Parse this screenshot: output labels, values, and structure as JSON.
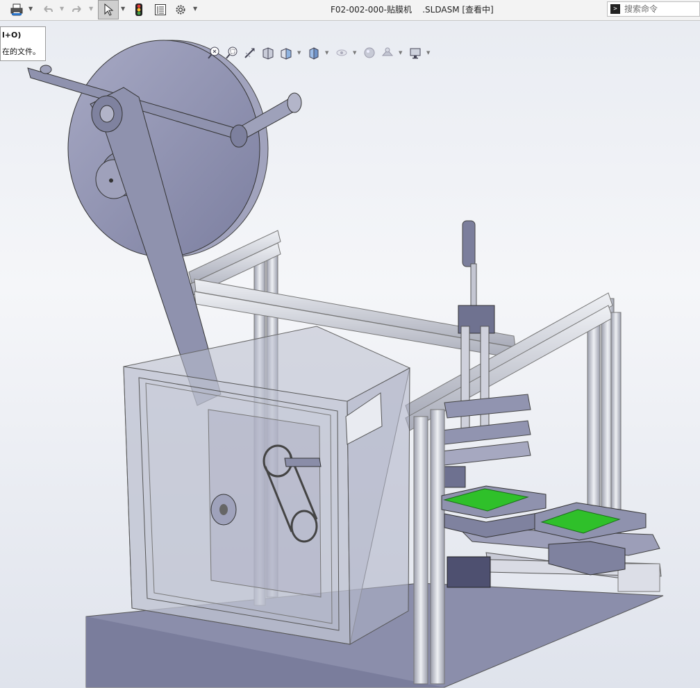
{
  "window": {
    "title": "F02-002-000-贴膜机    .SLDASM [查看中]"
  },
  "toolbar": {
    "icons": [
      "print-icon",
      "undo-icon",
      "redo-icon",
      "select-pointer-icon",
      "traffic-light-icon",
      "file-properties-icon",
      "options-gear-icon"
    ]
  },
  "search": {
    "placeholder": "搜索命令",
    "prompt_symbol": ">"
  },
  "tooltip": {
    "title": "l+O)",
    "text": "在的文件。"
  },
  "headsup": {
    "icons": [
      "zoom-to-fit-icon",
      "zoom-to-area-icon",
      "previous-view-icon",
      "section-view-icon",
      "view-orientation-icon",
      "display-style-icon",
      "hide-show-items-icon",
      "edit-appearance-icon",
      "apply-scene-icon",
      "view-settings-icon"
    ]
  },
  "colors": {
    "metal": "#8e90b0",
    "metal_dark": "#5e6080",
    "aluminum": "#c9cbd6",
    "pcb_green": "#2fc02a",
    "glass": "#b8bccd"
  }
}
